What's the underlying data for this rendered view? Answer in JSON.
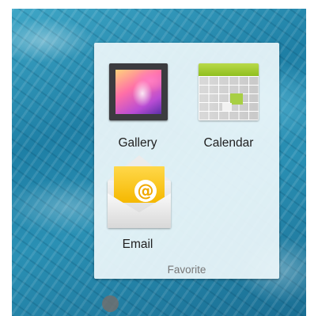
{
  "folder": {
    "name": "Favorite",
    "apps": [
      {
        "label": "Gallery",
        "icon": "gallery-icon"
      },
      {
        "label": "Calendar",
        "icon": "calendar-icon"
      },
      {
        "label": "Email",
        "icon": "email-icon"
      }
    ]
  },
  "email": {
    "glyph": "@"
  },
  "colors": {
    "folder_background": "#ecf6fa",
    "wallpaper": "#1e7fa5",
    "calendar_accent": "#a8cf44",
    "email_accent": "#f5b800"
  }
}
